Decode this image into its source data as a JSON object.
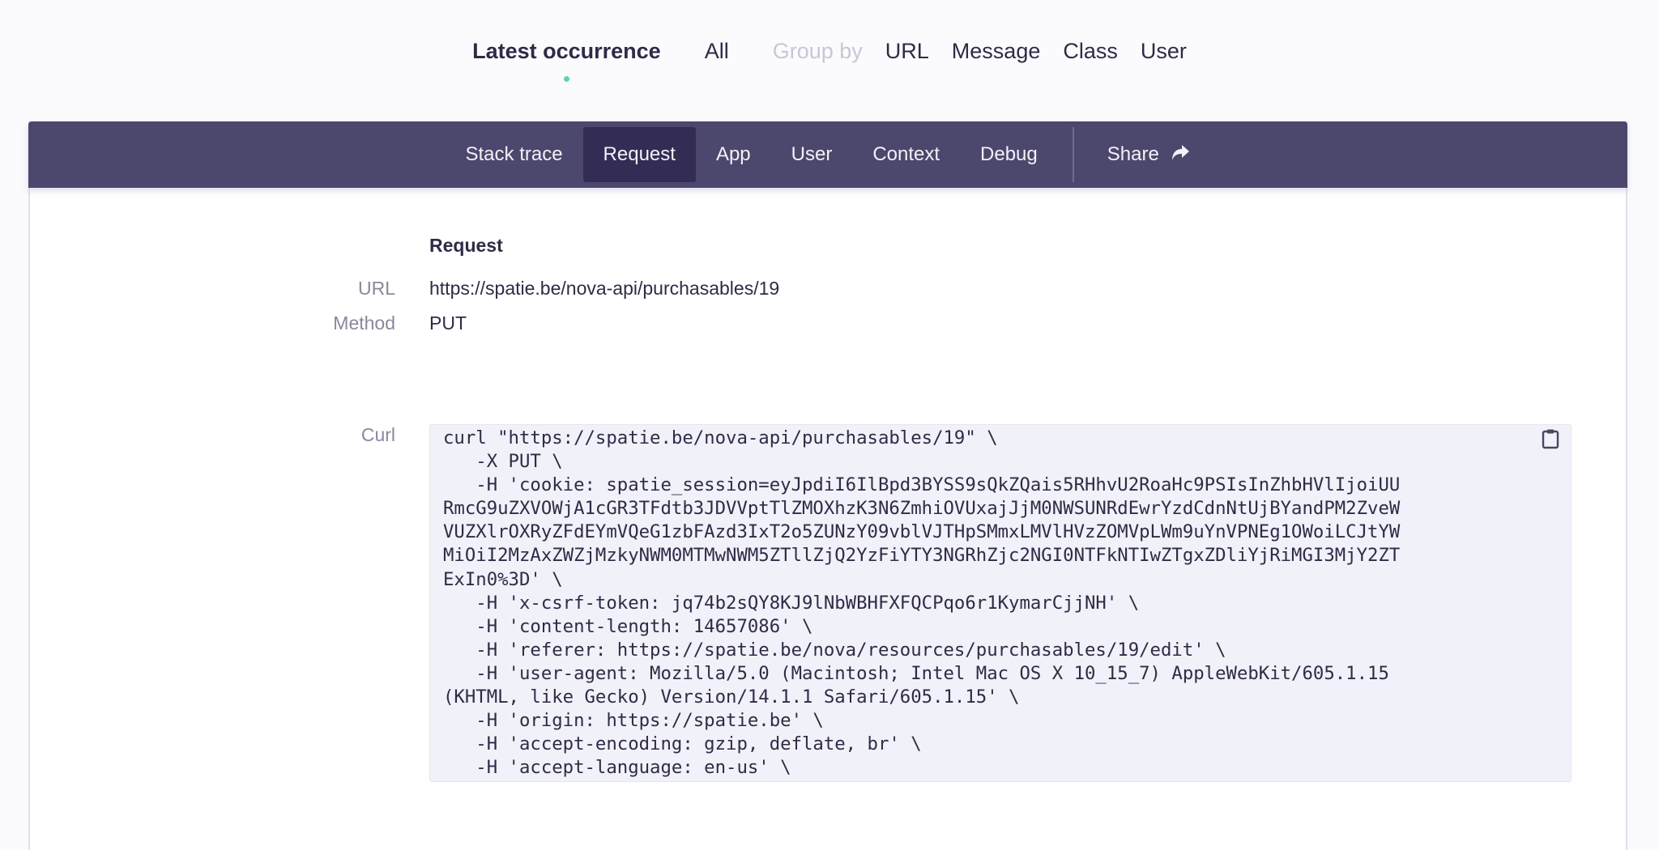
{
  "top_nav": {
    "latest": "Latest occurrence",
    "all": "All",
    "group_by_label": "Group by",
    "group_options": [
      "URL",
      "Message",
      "Class",
      "User"
    ]
  },
  "tabs": {
    "items": [
      "Stack trace",
      "Request",
      "App",
      "User",
      "Context",
      "Debug"
    ],
    "selected": "Request",
    "share": "Share",
    "share_icon": "share-arrow-icon"
  },
  "request": {
    "title": "Request",
    "url_label": "URL",
    "url": "https://spatie.be/nova-api/purchasables/19",
    "method_label": "Method",
    "method": "PUT",
    "curl_label": "Curl",
    "copy_icon": "clipboard-icon",
    "curl_lines": [
      "curl \"https://spatie.be/nova-api/purchasables/19\" \\",
      "   -X PUT \\",
      "   -H 'cookie: spatie_session=eyJpdiI6IlBpd3BYSS9sQkZQais5RHhvU2RoaHc9PSIsInZhbHVlIjoiUU",
      "RmcG9uZXVOWjA1cGR3TFdtb3JDVVptTlZMOXhzK3N6ZmhiOVUxajJjM0NWSUNRdEwrYzdCdnNtUjBYandPM2ZveW",
      "VUZXlrOXRyZFdEYmVQeG1zbFAzd3IxT2o5ZUNzY09vblVJTHpSMmxLMVlHVzZOMVpLWm9uYnVPNEg1OWoiLCJtYW",
      "MiOiI2MzAxZWZjMzkyNWM0MTMwNWM5ZTllZjQ2YzFiYTY3NGRhZjc2NGI0NTFkNTIwZTgxZDliYjRiMGI3MjY2ZT",
      "ExIn0%3D' \\",
      "   -H 'x-csrf-token: jq74b2sQY8KJ9lNbWBHFXFQCPqo6r1KymarCjjNH' \\",
      "   -H 'content-length: 14657086' \\",
      "   -H 'referer: https://spatie.be/nova/resources/purchasables/19/edit' \\",
      "   -H 'user-agent: Mozilla/5.0 (Macintosh; Intel Mac OS X 10_15_7) AppleWebKit/605.1.15",
      "(KHTML, like Gecko) Version/14.1.1 Safari/605.1.15' \\",
      "   -H 'origin: https://spatie.be' \\",
      "   -H 'accept-encoding: gzip, deflate, br' \\",
      "   -H 'accept-language: en-us' \\"
    ]
  },
  "colors": {
    "tabbar_bg": "#4c476c",
    "tab_selected_bg": "#332d55",
    "active_dot": "#5ed4a4",
    "text": "#2f2b46",
    "muted": "#8a879e",
    "group_label": "#c8c6d8",
    "code_bg": "#f1f1f9"
  }
}
